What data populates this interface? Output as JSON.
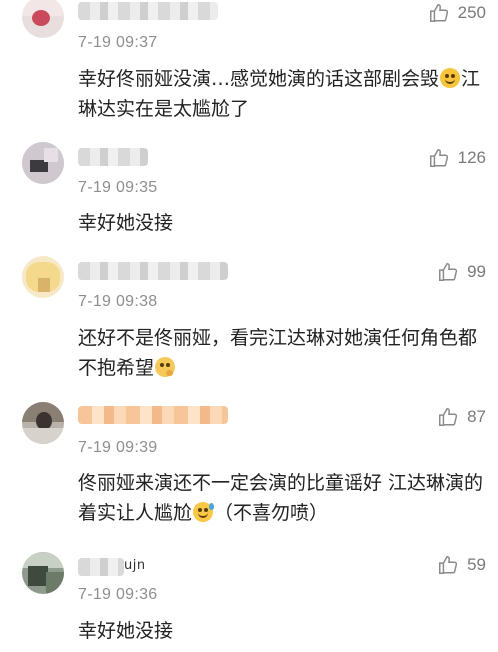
{
  "comments": [
    {
      "time": "7-19 09:37",
      "likes": "250",
      "text_before": "幸好佟丽娅没演…感觉她演的话这部剧会毁",
      "emoji": "laughing-tears",
      "text_after": "江琳达实在是太尴尬了"
    },
    {
      "time": "7-19 09:35",
      "likes": "126",
      "text": "幸好她没接"
    },
    {
      "time": "7-19 09:38",
      "likes": "99",
      "text_before": "还好不是佟丽娅，看完江达琳对她演任何角色都不抱希望",
      "emoji": "thinking-face",
      "text_after": ""
    },
    {
      "time": "7-19 09:39",
      "likes": "87",
      "text_before": "佟丽娅来演还不一定会演的比童谣好 江达琳演的着实让人尴尬",
      "emoji": "sweat-smile",
      "text_after": "（不喜勿喷）"
    },
    {
      "time": "7-19 09:36",
      "likes": "59",
      "name_suffix": "ujn",
      "text": "幸好她没接"
    }
  ],
  "icons": {
    "like": "thumbs-up-icon"
  },
  "colors": {
    "text": "#222222",
    "meta": "#8e8e8e",
    "like": "#7a7a7a"
  }
}
